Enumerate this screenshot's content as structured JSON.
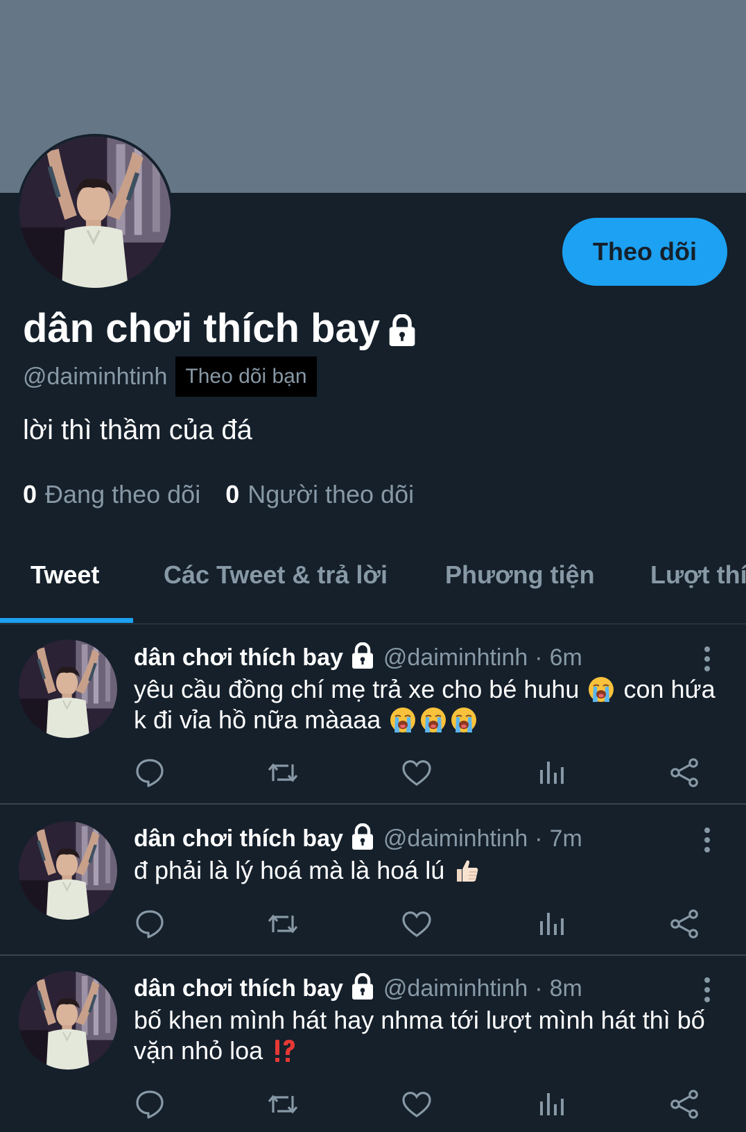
{
  "profile": {
    "display_name": "dân chơi thích bay",
    "handle": "@daiminhtinh",
    "follows_you_label": "Theo dõi bạn",
    "bio": "lời thì thầm của đá",
    "follow_button_label": "Theo dõi",
    "following_count": "0",
    "following_label": "Đang theo dõi",
    "followers_count": "0",
    "followers_label": "Người theo dõi",
    "protected_icon": "lock-icon"
  },
  "tabs": [
    {
      "label": "Tweet",
      "active": true
    },
    {
      "label": "Các Tweet & trả lời",
      "active": false
    },
    {
      "label": "Phương tiện",
      "active": false
    },
    {
      "label": "Lượt thíc",
      "active": false
    }
  ],
  "tweets": [
    {
      "name": "dân chơi thích bay",
      "handle": "@daiminhtinh",
      "separator": "·",
      "time": "6m",
      "text_parts": [
        "yêu cầu đồng chí mẹ trả xe cho bé huhu",
        "con hứa k đi vỉa hồ nữa màaaa"
      ],
      "emojis": [
        "loudly-crying-face",
        "loudly-crying-face",
        "loudly-crying-face",
        "loudly-crying-face"
      ]
    },
    {
      "name": "dân chơi thích bay",
      "handle": "@daiminhtinh",
      "separator": "·",
      "time": "7m",
      "text_parts": [
        "đ phải là lý hoá mà là hoá lú"
      ],
      "emojis": [
        "thumbs-up"
      ]
    },
    {
      "name": "dân chơi thích bay",
      "handle": "@daiminhtinh",
      "separator": "·",
      "time": "8m",
      "text_parts": [
        "bố khen mình hát hay nhma tới lượt mình hát thì bố vặn nhỏ loa"
      ],
      "emojis": [
        "exclamation-question-mark"
      ]
    }
  ],
  "action_icons": [
    "reply-icon",
    "retweet-icon",
    "like-icon",
    "analytics-icon",
    "share-icon"
  ],
  "colors": {
    "background": "#15202b",
    "banner": "#657786",
    "accent": "#1da1f2",
    "secondary_text": "#8899a6",
    "divider": "#38444d"
  }
}
